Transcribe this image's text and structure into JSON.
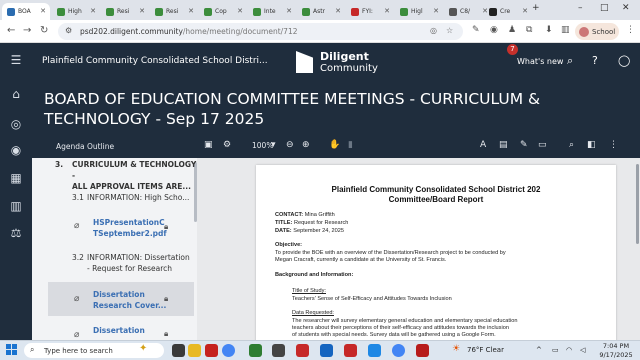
{
  "browser": {
    "tabs": [
      {
        "label": "BOA",
        "color": "#2b6cb0"
      },
      {
        "label": "High",
        "color": "#3c8d3c"
      },
      {
        "label": "Resi",
        "color": "#3c8d3c"
      },
      {
        "label": "Resi",
        "color": "#3c8d3c"
      },
      {
        "label": "Cop",
        "color": "#3c8d3c"
      },
      {
        "label": "Inte",
        "color": "#3c8d3c"
      },
      {
        "label": "Astr",
        "color": "#3c8d3c"
      },
      {
        "label": "FYI:",
        "color": "#c62828"
      },
      {
        "label": "Higl",
        "color": "#3c8d3c"
      },
      {
        "label": "C8/",
        "color": "#555555"
      },
      {
        "label": "Cre",
        "color": "#222222"
      }
    ],
    "url_host": "psd202.diligent.community",
    "url_path": "/home/meeting/document/712",
    "profile_label": "School"
  },
  "app": {
    "org_name": "Plainfield Community Consolidated School Distri...",
    "logo_line1": "Diligent",
    "logo_line2": "Community",
    "notification_count": "7",
    "whats_new": "What's new",
    "page_title": "BOARD OF EDUCATION COMMITTEE MEETINGS - CURRICULUM & TECHNOLOGY - Sep 17 2025"
  },
  "toolbar": {
    "outline_label": "Agenda Outline",
    "zoom": "100%"
  },
  "outline": {
    "section_number": "3.",
    "section_title_line1": "CURRICULUM & TECHNOLOGY -",
    "section_title_line2": "ALL APPROVAL ITEMS ARE...",
    "item1_number": "3.1",
    "item1_title": "INFORMATION: High Scho...",
    "file1_line1": "HSPresentationC",
    "file1_line2": "TSeptember2.pdf",
    "item2_number": "3.2",
    "item2_title_line1": "INFORMATION: Dissertation",
    "item2_title_line2": "- Request for Research",
    "file2_line1": "Dissertation",
    "file2_line2": "Research Cover...",
    "file3_line1": "Dissertation"
  },
  "document": {
    "title_line1": "Plainfield Community Consolidated School District 202",
    "title_line2": "Committee/Board Report",
    "contact_label": "CONTACT:",
    "contact_value": "Mina Griffith",
    "title_label": "TITLE:",
    "title_value": "Request for Research",
    "date_label": "DATE:",
    "date_value": "September 24, 2025",
    "objective_heading": "Objective:",
    "objective_line1": "To provide the BOE with an overview of the Dissertation/Research project to be conducted by",
    "objective_line2": "Megan Cracraft, currently a candidate at the University of St. Francis.",
    "background_heading": "Background and Information:",
    "study_heading": "Title of Study:",
    "study_value": "Teachers' Sense of Self-Efficacy and Attitudes Towards Inclusion",
    "data_heading": "Data Requested:",
    "data_line1": "The researcher will survey elementary general education and elementary special education",
    "data_line2": "teachers about their perceptions of their self-efficacy and attitudes towards the inclusion",
    "data_line3": "of students with special needs.  Survey data will be gathered using a Google Form."
  },
  "taskbar": {
    "search_placeholder": "Type here to search",
    "weather": "76°F  Clear",
    "time": "7:04 PM",
    "date": "9/17/2025"
  }
}
